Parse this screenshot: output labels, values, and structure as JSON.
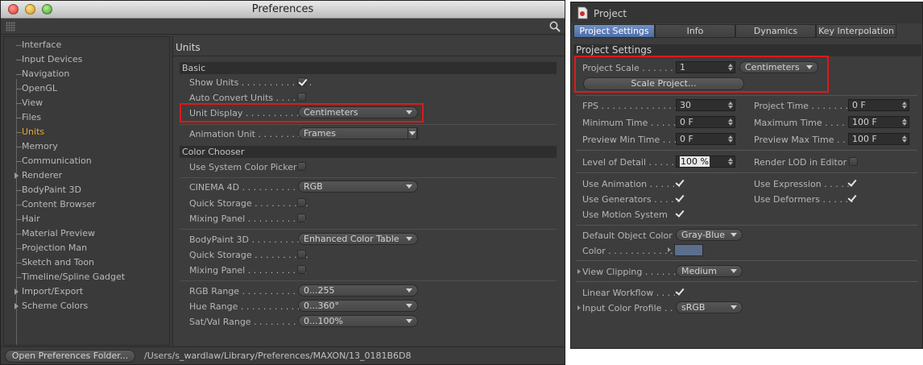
{
  "prefs": {
    "title": "Preferences",
    "tree": [
      {
        "label": "Interface"
      },
      {
        "label": "Input Devices"
      },
      {
        "label": "Navigation"
      },
      {
        "label": "OpenGL"
      },
      {
        "label": "View"
      },
      {
        "label": "Files"
      },
      {
        "label": "Units"
      },
      {
        "label": "Memory"
      },
      {
        "label": "Communication"
      },
      {
        "label": "Renderer"
      },
      {
        "label": "BodyPaint 3D"
      },
      {
        "label": "Content Browser"
      },
      {
        "label": "Hair"
      },
      {
        "label": "Material Preview"
      },
      {
        "label": "Projection Man"
      },
      {
        "label": "Sketch and Toon"
      },
      {
        "label": "Timeline/Spline Gadget"
      },
      {
        "label": "Import/Export"
      },
      {
        "label": "Scheme Colors"
      }
    ],
    "panel_title": "Units",
    "basic": {
      "header": "Basic",
      "show_units_label": "Show Units . . . . . . . . . . . . .",
      "auto_convert_label": "Auto Convert Units . . . . .",
      "unit_display_label": "Unit Display . . . . . . . . . . . .",
      "unit_display_value": "Centimeters",
      "animation_unit_label": "Animation Unit . . . . . . . . .",
      "animation_unit_value": "Frames"
    },
    "color_chooser": {
      "header": "Color Chooser",
      "system_picker_label": "Use System Color Picker",
      "cinema4d_label": "CINEMA 4D . . . . . . . . . . . .",
      "cinema4d_value": "RGB",
      "quick_storage_label": "Quick Storage . . . . . . . . . .",
      "mixing_panel_label": "Mixing Panel . . . . . . . . . . .",
      "bodypaint_label": "BodyPaint 3D . . . . . . . . . .",
      "bodypaint_value": "Enhanced Color Table",
      "quick_storage2_label": "Quick Storage . . . . . . . . . .",
      "mixing_panel2_label": "Mixing Panel . . . . . . . . . . .",
      "rgb_range_label": "RGB Range . . . . . . . . . . . .",
      "rgb_range_value": "0...255",
      "hue_range_label": "Hue Range . . . . . . . . . . . .",
      "hue_range_value": "0...360°",
      "satval_range_label": "Sat/Val Range . . . . . . . . . .",
      "satval_range_value": "0...100%"
    },
    "open_folder_button": "Open Preferences Folder...",
    "path": "/Users/s_wardlaw/Library/Preferences/MAXON/13_0181B6D8"
  },
  "project": {
    "title": "Project",
    "tabs": [
      "Project Settings",
      "Info",
      "Dynamics",
      "Key Interpolation"
    ],
    "section": "Project Settings",
    "scale_label": "Project Scale . . . . . . .",
    "scale_value": "1",
    "scale_unit": "Centimeters",
    "scale_button": "Scale Project...",
    "fps_label": "FPS . . . . . . . . . . . . . . . .",
    "fps_value": "30",
    "project_time_label": "Project Time . . . . . . .",
    "project_time_value": "0 F",
    "min_time_label": "Minimum Time . . . . .",
    "min_time_value": "0 F",
    "max_time_label": "Maximum Time . . . . .",
    "max_time_value": "100 F",
    "preview_min_label": "Preview Min Time . . .",
    "preview_min_value": "0 F",
    "preview_max_label": "Preview Max Time . . .",
    "preview_max_value": "100 F",
    "lod_label": "Level of Detail . . . . . .",
    "lod_value": "100 %",
    "render_lod_label": "Render LOD in Editor",
    "use_animation_label": "Use Animation . . . . . .",
    "use_expression_label": "Use Expression . . . . .",
    "use_generators_label": "Use Generators . . . . .",
    "use_deformers_label": "Use Deformers . . . . . .",
    "use_motion_label": "Use Motion System",
    "default_color_label": "Default Object Color",
    "default_color_value": "Gray-Blue",
    "color_label": "Color . . . . . . . . . . . .",
    "color_swatch": "#5b6f8c",
    "view_clipping_label": "View Clipping . . . . . .",
    "view_clipping_value": "Medium",
    "linear_workflow_label": "Linear Workflow . . . .",
    "input_profile_label": "Input Color Profile . .",
    "input_profile_value": "sRGB"
  },
  "colors": {
    "active_tree": "#e8a832",
    "highlight": "#e01818",
    "tab_active": "#5a7bb3"
  }
}
